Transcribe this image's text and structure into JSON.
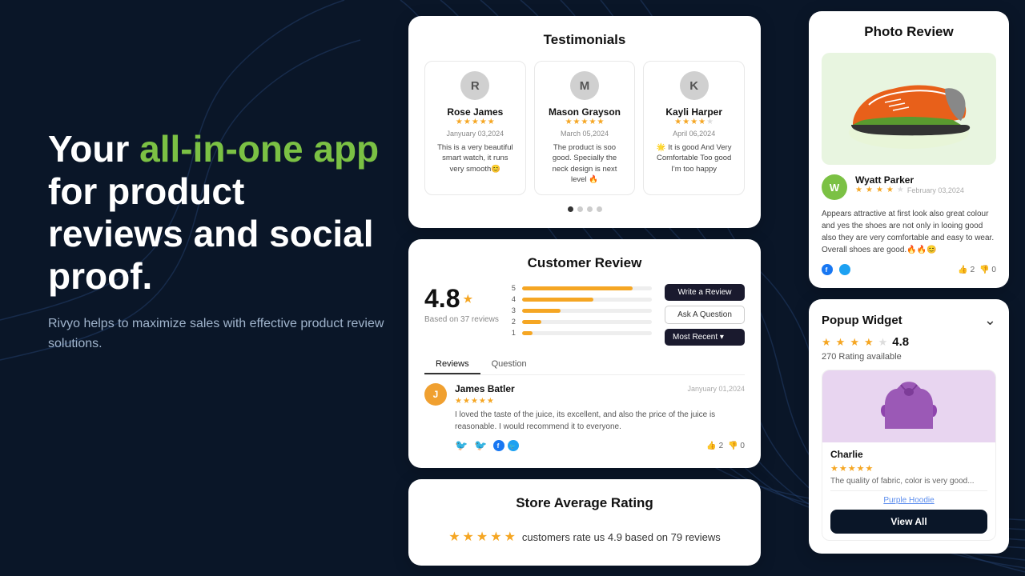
{
  "background": {
    "color": "#0a1628"
  },
  "hero": {
    "heading_part1": "Your ",
    "heading_highlight": "all-in-one app",
    "heading_part2": " for product reviews and social proof.",
    "subtext": "Rivyo helps to maximize sales with effective product review solutions."
  },
  "testimonials_card": {
    "title": "Testimonials",
    "reviewers": [
      {
        "initial": "R",
        "name": "Rose James",
        "date": "Janyuary 03,2024",
        "stars": 5,
        "text": "This is a very beautiful smart watch, it runs very smooth😊"
      },
      {
        "initial": "M",
        "name": "Mason Grayson",
        "date": "March 05,2024",
        "stars": 5,
        "text": "The product is soo good. Specially the neck design is next level 🔥"
      },
      {
        "initial": "K",
        "name": "Kayli Harper",
        "date": "April 06,2024",
        "stars": 4,
        "text": "🌟 It is good And Very Comfortable Too good I'm too happy"
      }
    ],
    "dots": [
      true,
      false,
      false,
      false
    ]
  },
  "customer_review_card": {
    "title": "Customer Review",
    "average": "4.8",
    "star_color": "#f5a623",
    "based_on": "Based on 37 reviews",
    "bars": [
      {
        "label": "5",
        "width": 85
      },
      {
        "label": "4",
        "width": 55
      },
      {
        "label": "3",
        "width": 30
      },
      {
        "label": "2",
        "width": 15
      },
      {
        "label": "1",
        "width": 8
      }
    ],
    "buttons": {
      "write": "Write a Review",
      "question": "Ask A Question",
      "recent": "Most Recent ▾"
    },
    "tabs": [
      "Reviews",
      "Question"
    ],
    "active_tab": 0,
    "review": {
      "initial": "J",
      "name": "James Batler",
      "date": "Janyuary 01,2024",
      "stars": 5,
      "text": "I loved the taste of the juice, its excellent, and also the price of the juice is reasonable. I would recommend it to everyone.",
      "likes": 2,
      "dislikes": 0
    }
  },
  "store_average_card": {
    "title": "Store Average Rating",
    "text": "customers rate us 4.9 based on 79 reviews",
    "stars": 5
  },
  "photo_review_card": {
    "title": "Photo Review",
    "reviewer": {
      "initial": "W",
      "name": "Wyatt Parker",
      "date": "February 03,2024",
      "stars": 4
    },
    "review_text": "Appears attractive at first look also great colour and yes the shoes are not only in looing good also they are very comfortable and easy to wear. Overall shoes are good.🔥🔥😊",
    "likes": 2,
    "dislikes": 0
  },
  "popup_widget_card": {
    "title": "Popup Widget",
    "rating": "4.8",
    "reviews_count": "270 Rating available",
    "product": {
      "name": "Charlie",
      "review_text": "The quality of fabric, color is very good...",
      "link": "Purple Hoodie"
    },
    "view_all_btn": "View All"
  }
}
